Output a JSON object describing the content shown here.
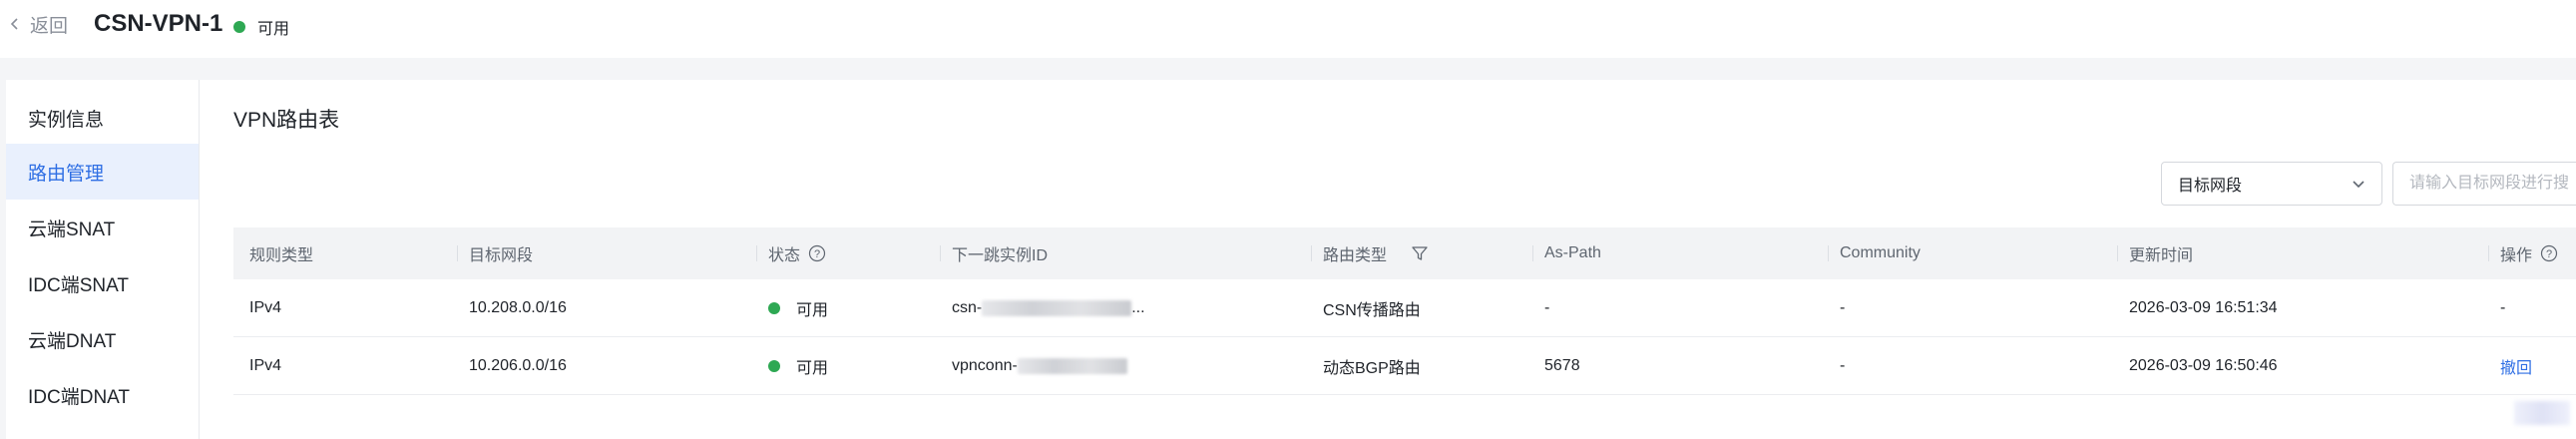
{
  "header": {
    "back_label": "返回",
    "title": "CSN-VPN-1",
    "status": "可用",
    "status_color": "#2ea853"
  },
  "sidebar": {
    "items": [
      {
        "label": "实例信息",
        "active": false
      },
      {
        "label": "路由管理",
        "active": true
      },
      {
        "label": "云端SNAT",
        "active": false
      },
      {
        "label": "IDC端SNAT",
        "active": false
      },
      {
        "label": "云端DNAT",
        "active": false
      },
      {
        "label": "IDC端DNAT",
        "active": false
      }
    ]
  },
  "main": {
    "section_title": "VPN路由表",
    "filter_select": "目标网段",
    "search_placeholder": "请输入目标网段进行搜"
  },
  "table": {
    "columns": [
      "规则类型",
      "目标网段",
      "状态",
      "下一跳实例ID",
      "路由类型",
      "As-Path",
      "Community",
      "更新时间",
      "操作"
    ],
    "rows": [
      {
        "rule_type": "IPv4",
        "target": "10.208.0.0/16",
        "status": "可用",
        "next_hop_prefix": "csn-",
        "next_hop_suffix": "...",
        "route_type": "CSN传播路由",
        "as_path": "-",
        "community": "-",
        "updated": "2026-03-09 16:51:34",
        "action": "-"
      },
      {
        "rule_type": "IPv4",
        "target": "10.206.0.0/16",
        "status": "可用",
        "next_hop_prefix": "vpnconn-",
        "next_hop_suffix": "",
        "route_type": "动态BGP路由",
        "as_path": "5678",
        "community": "-",
        "updated": "2026-03-09 16:50:46",
        "action": "撤回"
      }
    ]
  },
  "colors": {
    "accent": "#2f6fe4",
    "active_nav_bg": "#e9f0fd",
    "available": "#2ea853"
  },
  "icons": [
    "chevron-left-icon",
    "status-dot-icon",
    "chevron-down-icon",
    "help-icon",
    "filter-icon"
  ]
}
